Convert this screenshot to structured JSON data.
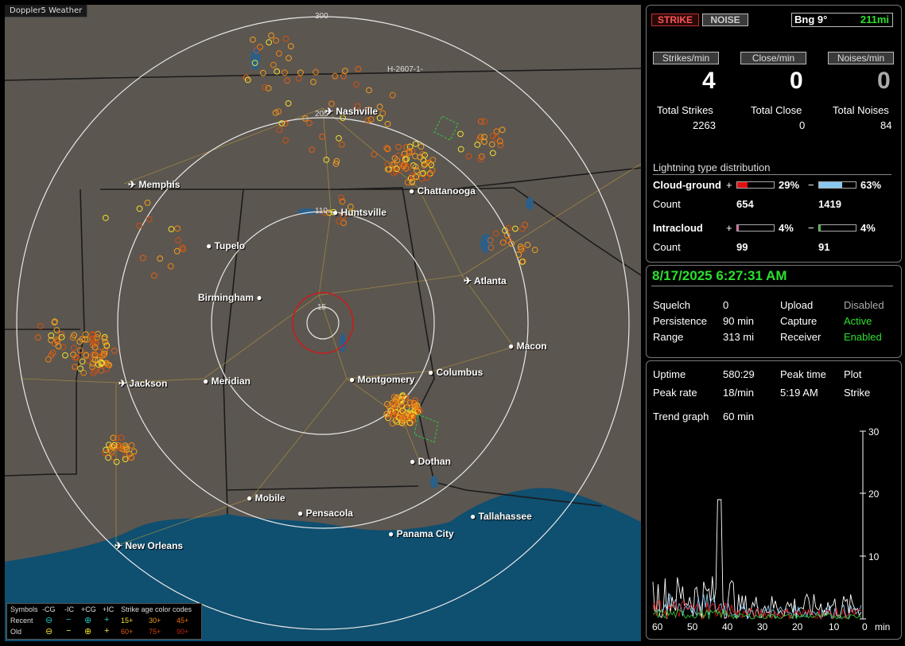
{
  "app": {
    "title": "Doppler5 Weather"
  },
  "map": {
    "range_labels": [
      "300",
      "205",
      "110",
      "15"
    ],
    "annotation": "H-2607-1-",
    "cities": [
      {
        "name": "Nashville",
        "airport": true
      },
      {
        "name": "Memphis",
        "airport": true
      },
      {
        "name": "Chattanooga",
        "airport": false
      },
      {
        "name": "Huntsville",
        "airport": false
      },
      {
        "name": "Tupelo",
        "airport": false
      },
      {
        "name": "Atlanta",
        "airport": true
      },
      {
        "name": "Birmingham",
        "airport": false
      },
      {
        "name": "Macon",
        "airport": false
      },
      {
        "name": "Jackson",
        "airport": true
      },
      {
        "name": "Meridian",
        "airport": false
      },
      {
        "name": "Montgomery",
        "airport": false
      },
      {
        "name": "Columbus",
        "airport": false
      },
      {
        "name": "Dothan",
        "airport": false
      },
      {
        "name": "Mobile",
        "airport": false
      },
      {
        "name": "Pensacola",
        "airport": false
      },
      {
        "name": "Tallahassee",
        "airport": false
      },
      {
        "name": "Panama City",
        "airport": false
      },
      {
        "name": "New Orleans",
        "airport": true
      }
    ],
    "legend": {
      "symbols_label": "Symbols",
      "headers": [
        "-CG",
        "-IC",
        "+CG",
        "+IC"
      ],
      "recent_label": "Recent",
      "old_label": "Old",
      "color_codes_label": "Strike age color codes",
      "recent_ages": [
        "15+",
        "30+",
        "45+"
      ],
      "old_ages": [
        "60+",
        "75+",
        "90+"
      ]
    }
  },
  "status": {
    "strike_tab": "STRIKE",
    "noise_tab": "NOISE",
    "bearing": "Bng 9°",
    "distance": "211mi",
    "rate_buttons": [
      "Strikes/min",
      "Close/min",
      "Noises/min"
    ],
    "rates": [
      "4",
      "0",
      "0"
    ],
    "total_labels": [
      "Total Strikes",
      "Total Close",
      "Total Noises"
    ],
    "totals": [
      "2263",
      "0",
      "84"
    ],
    "distribution_title": "Lightning type distribution",
    "cg_label": "Cloud-ground",
    "ic_label": "Intracloud",
    "count_label": "Count",
    "cg_pos_pct": "29%",
    "cg_neg_pct": "63%",
    "cg_pos_count": "654",
    "cg_neg_count": "1419",
    "ic_pos_pct": "4%",
    "ic_neg_pct": "4%",
    "ic_pos_count": "99",
    "ic_neg_count": "91",
    "cg_pos_fraction": 0.29,
    "cg_neg_fraction": 0.63,
    "ic_pos_fraction": 0.04,
    "ic_neg_fraction": 0.04
  },
  "settings": {
    "datetime": "8/17/2025 6:27:31 AM",
    "squelch_label": "Squelch",
    "squelch": "0",
    "persistence_label": "Persistence",
    "persistence": "90 min",
    "range_label": "Range",
    "range": "313 mi",
    "upload_label": "Upload",
    "upload": "Disabled",
    "capture_label": "Capture",
    "capture": "Active",
    "receiver_label": "Receiver",
    "receiver": "Enabled"
  },
  "trend": {
    "uptime_label": "Uptime",
    "uptime": "580:29",
    "peak_time_label": "Peak time",
    "plot_label": "Plot",
    "peak_rate_label": "Peak rate",
    "peak_rate": "18/min",
    "peak_time": "5:19 AM",
    "plot": "Strike",
    "trend_graph_label": "Trend graph",
    "trend_graph": "60 min",
    "y_ticks": [
      "30",
      "20",
      "10"
    ],
    "x_ticks": [
      "60",
      "50",
      "40",
      "30",
      "20",
      "10",
      "0"
    ],
    "x_unit": "min"
  },
  "colors": {
    "accent_green": "#2ce02c",
    "strike_red": "#cc2222",
    "cg_pos": "#e01010",
    "cg_neg": "#88c8f0",
    "ic_pos": "#e060a0",
    "ic_neg": "#30c030"
  }
}
